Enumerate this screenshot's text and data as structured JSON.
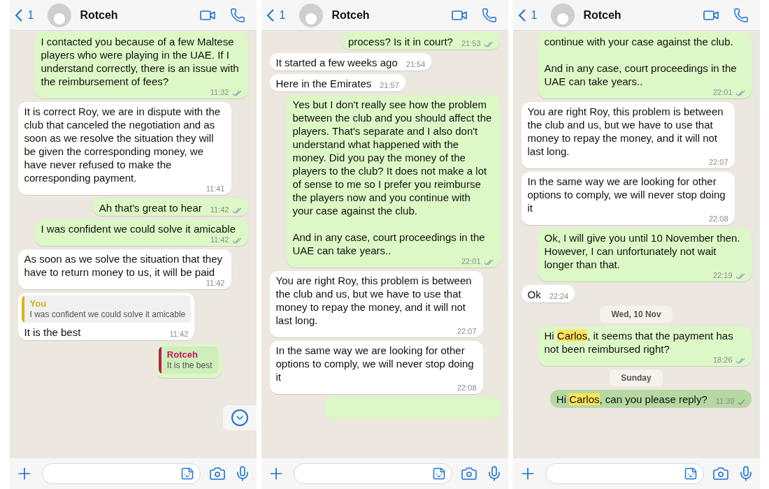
{
  "panels": [
    {
      "header": {
        "back_count": "1",
        "name": "Rotceh"
      },
      "scroll_down_button": true,
      "messages": [
        {
          "kind": "out",
          "text": "I contacted you because of a few Maltese players who were playing in the UAE. If I understand correctly, there is an issue with the reimbursement of fees?",
          "time": "11:32",
          "read": true,
          "selected": false
        },
        {
          "kind": "in",
          "text": "It is correct Roy, we are in dispute with the club that canceled the negotiation and as soon as we resolve the situation they will be given the corresponding money, we have never refused to make the corresponding payment.",
          "time": "11:41"
        },
        {
          "kind": "out",
          "text": "Ah that's great to hear",
          "time": "11:42",
          "read": true,
          "selected": false
        },
        {
          "kind": "out",
          "text": "I was confident we could solve it amicable",
          "time": "11:42",
          "read": true,
          "selected": false
        },
        {
          "kind": "in",
          "text": "As soon as we solve the situation that they have to return money to us, it will be paid",
          "time": "11:42"
        },
        {
          "kind": "in",
          "quote": {
            "author": "You",
            "text": "I was confident we could solve it amicable",
            "color": "#d4b41a"
          },
          "text": "It is the best",
          "time": "11:42"
        },
        {
          "kind": "out",
          "quote": {
            "author": "Rotceh",
            "text": "It is the best",
            "color": "#c2185b"
          },
          "selected": false
        }
      ]
    },
    {
      "header": {
        "back_count": "1",
        "name": "Rotceh"
      },
      "scroll_down_button": false,
      "messages": [
        {
          "kind": "out",
          "text": "process? Is it in court?",
          "time": "21:53",
          "read": true,
          "selected": false
        },
        {
          "kind": "in",
          "text": "It started a few weeks ago",
          "time": "21:54"
        },
        {
          "kind": "in",
          "text": "Here in the Emirates",
          "time": "21:57"
        },
        {
          "kind": "out",
          "text": "Yes but I don't really see how the problem between the club and you should affect the players. That's separate and I also don't understand what happened with the money. Did you pay the money of the players to the club? It does not make a lot of sense to me so I prefer you reimburse the players now and you continue with your case against the club.\n\nAnd in any case, court proceedings in the UAE can take years..",
          "time": "22:01",
          "read": true,
          "selected": false
        },
        {
          "kind": "in",
          "text": "You are right Roy, this problem is between the club and us, but we have to use that money to repay the money, and it will not last long.",
          "time": "22:07"
        },
        {
          "kind": "in",
          "text": "In the same way we are looking for other options to comply, we will never stop doing it",
          "time": "22:08"
        },
        {
          "kind": "stub"
        }
      ]
    },
    {
      "header": {
        "back_count": "1",
        "name": "Rotceh"
      },
      "scroll_down_button": false,
      "messages": [
        {
          "kind": "out",
          "text": "continue with your case against the club.\n\nAnd in any case, court proceedings in the UAE can take years..",
          "time": "22:01",
          "read": true,
          "selected": false
        },
        {
          "kind": "in",
          "text": "You are right Roy, this problem is between the club and us, but we have to use that money to repay the money, and it will not last long.",
          "time": "22:07"
        },
        {
          "kind": "in",
          "text": "In the same way we are looking for other options to comply, we will never stop doing it",
          "time": "22:08"
        },
        {
          "kind": "out",
          "text": "Ok, I will give you until 10 November then. However, I can unfortunately not wait longer than that.",
          "time": "22:19",
          "read": true,
          "selected": false
        },
        {
          "kind": "in",
          "text": "Ok",
          "time": "22:24"
        },
        {
          "kind": "date",
          "text": "Wed, 10 Nov"
        },
        {
          "kind": "out",
          "segments": [
            {
              "text": "Hi ",
              "highlighted": false
            },
            {
              "text": "Carlos",
              "highlighted": true
            },
            {
              "text": ", it seems that the payment has not been reimbursed right?",
              "highlighted": false
            }
          ],
          "time": "18:26",
          "read": true,
          "selected": false
        },
        {
          "kind": "date",
          "text": "Sunday"
        },
        {
          "kind": "out",
          "segments": [
            {
              "text": "Hi ",
              "highlighted": false
            },
            {
              "text": "Carlos",
              "highlighted": true
            },
            {
              "text": ", can you please reply?",
              "highlighted": false
            }
          ],
          "time": "11:39",
          "read": false,
          "selected": true
        }
      ]
    }
  ]
}
